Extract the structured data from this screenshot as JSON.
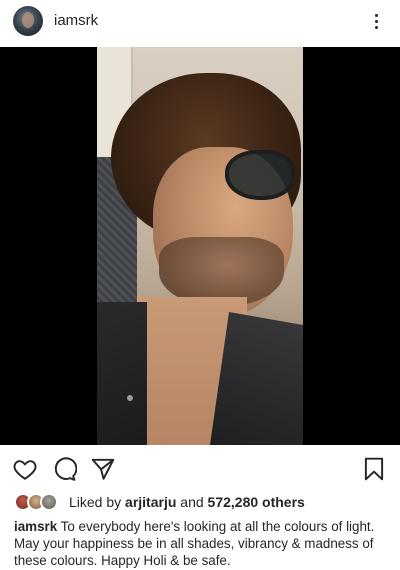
{
  "header": {
    "username": "iamsrk",
    "more_icon": "more-vertical-icon"
  },
  "post": {
    "image_alt": "photo"
  },
  "actions": {
    "like_icon": "heart-icon",
    "comment_icon": "comment-icon",
    "share_icon": "paper-plane-icon",
    "save_icon": "bookmark-icon"
  },
  "likes": {
    "prefix": "Liked by",
    "first_user": "arjitarju",
    "conjunction": "and",
    "count": "572,280 others"
  },
  "caption": {
    "username": "iamsrk",
    "text": "To everybody here's looking at all the colours of light. May your happiness be in all shades, vibrancy & madness of these colours. Happy Holi & be safe."
  }
}
